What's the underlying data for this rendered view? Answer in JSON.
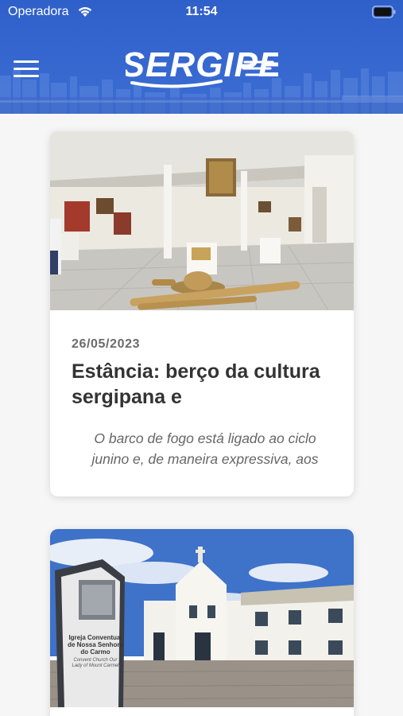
{
  "status_bar": {
    "carrier": "Operadora",
    "time": "11:54"
  },
  "header": {
    "logo_text": "SERGIPE",
    "menu_icon": "hamburger-menu-icon"
  },
  "colors": {
    "header_blue": "#3566cf",
    "card_background": "#ffffff",
    "page_background": "#f6f6f6"
  },
  "articles": [
    {
      "date": "26/05/2023",
      "title": "Estância: berço da cultura sergipana e",
      "excerpt": "O barco de fogo está ligado ao ciclo junino e, de maneira expressiva, aos",
      "image": "museum-exhibition-photo"
    },
    {
      "image": "colonial-church-photo",
      "sign_text": "Igreja Conventual de Nossa Senhora do Carmo",
      "sign_subtext": "Convent Church Our Lady of Mount Carmel"
    }
  ]
}
